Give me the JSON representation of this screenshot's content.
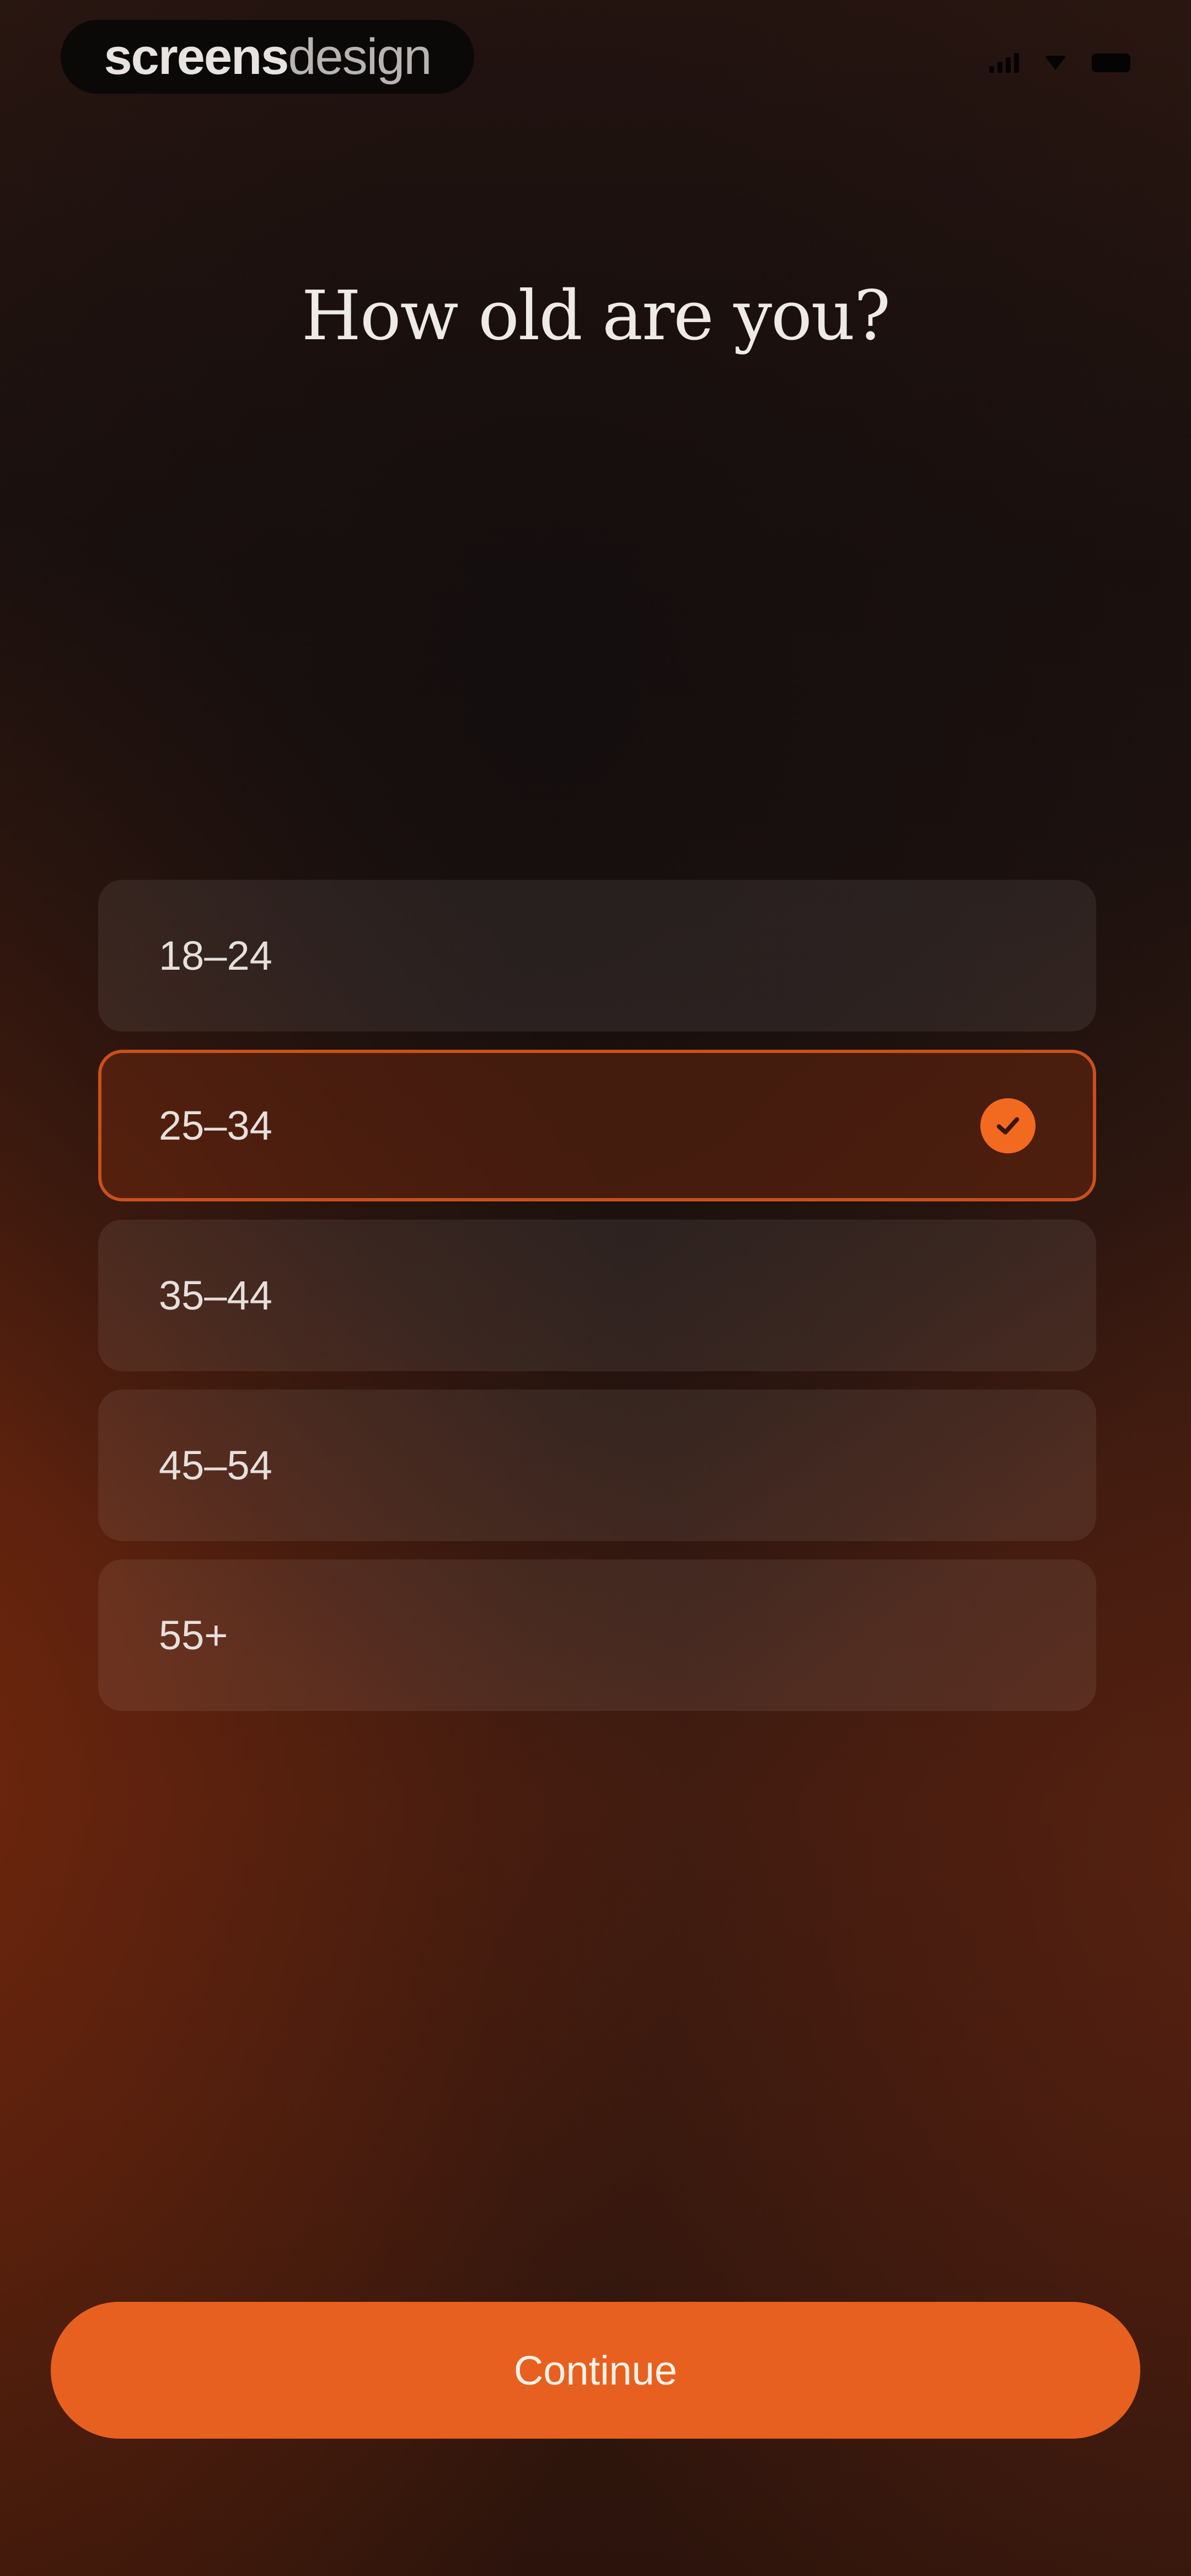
{
  "watermark": {
    "strong": "screens",
    "light": "design"
  },
  "question": "How old are you?",
  "options": [
    {
      "label": "18–24",
      "selected": false
    },
    {
      "label": "25–34",
      "selected": true
    },
    {
      "label": "35–44",
      "selected": false
    },
    {
      "label": "45–54",
      "selected": false
    },
    {
      "label": "55+",
      "selected": false
    }
  ],
  "selected_icon": "checkmark-circle-icon",
  "continue_label": "Continue",
  "colors": {
    "accent": "#e8601f",
    "selected_border": "#c9501c",
    "text": "#eeeae6"
  }
}
